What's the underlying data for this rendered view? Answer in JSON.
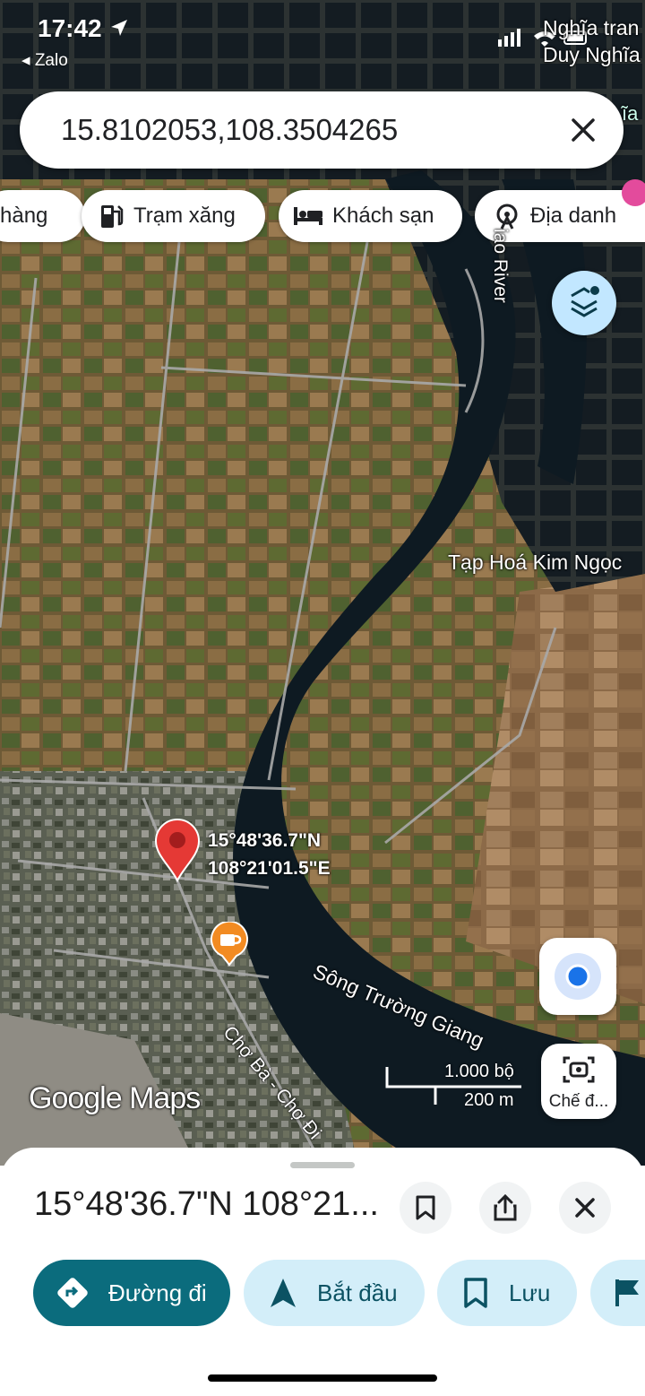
{
  "status_bar": {
    "time": "17:42",
    "back_app": "◂ Zalo"
  },
  "search": {
    "query": "15.8102053,108.3504265"
  },
  "chips": [
    {
      "label": "hàng",
      "icon": "shopping-icon"
    },
    {
      "label": "Trạm xăng",
      "icon": "gas-station-icon"
    },
    {
      "label": "Khách sạn",
      "icon": "hotel-bed-icon"
    },
    {
      "label": "Địa danh",
      "icon": "landmark-icon"
    }
  ],
  "map_labels": {
    "top_right_line1": "Nghĩa tran",
    "top_right_line2": "Duy Nghĩa",
    "top_right_partial": "ĩa",
    "river_vertical": "iao River",
    "shop": "Tạp Hoá Kim Ngọc",
    "river_name": "Sông Trường Giang",
    "road_name": "Chợ Bà - Chợ Đi",
    "pin_lat": "15°48'36.7\"N",
    "pin_lng": "108°21'01.5\"E"
  },
  "scale": {
    "imperial": "1.000 bộ",
    "metric": "200 m"
  },
  "brand": "Google Maps",
  "street_view_label": "Chế đ...",
  "sheet": {
    "title": "15°48'36.7\"N 108°21...",
    "actions": [
      {
        "label": "Đường đi",
        "icon": "directions-icon"
      },
      {
        "label": "Bắt đầu",
        "icon": "navigation-arrow-icon"
      },
      {
        "label": "Lưu",
        "icon": "bookmark-icon"
      }
    ]
  },
  "colors": {
    "accent": "#0b6c7d",
    "tonal": "#d3eef9",
    "pin": "#e53935",
    "cafe": "#f28b22"
  }
}
